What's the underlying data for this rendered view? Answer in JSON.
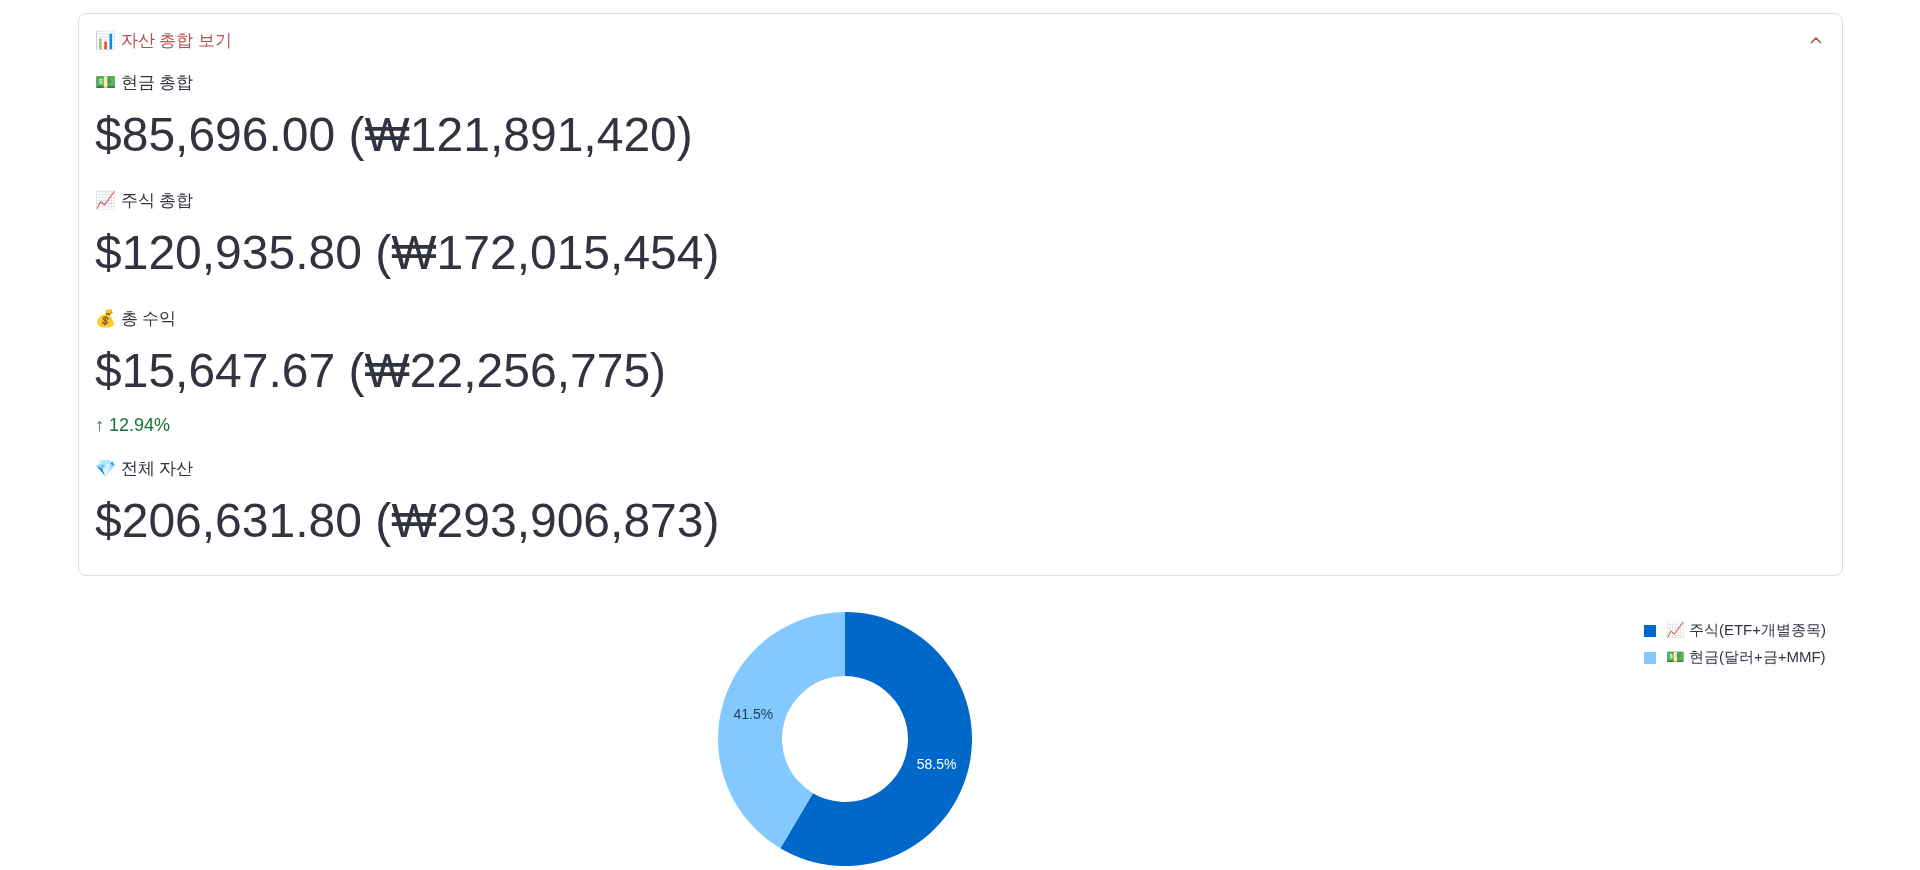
{
  "expander": {
    "title": "📊 자산 총합 보기",
    "expanded": true,
    "metrics": [
      {
        "label": "💵 현금 총합",
        "value": "$85,696.00 (₩121,891,420)"
      },
      {
        "label": "📈 주식 총합",
        "value": "$120,935.80 (₩172,015,454)"
      },
      {
        "label": "💰 총 수익",
        "value": "$15,647.67 (₩22,256,775)",
        "delta": {
          "text": "↑ 12.94%",
          "positive": true
        }
      },
      {
        "label": "💎 전체 자산",
        "value": "$206,631.80 (₩293,906,873)"
      }
    ]
  },
  "chart": {
    "chart_data": {
      "type": "donut",
      "categories": [
        "📈 주식(ETF+개별종목)",
        "💵 현금(달러+금+MMF)"
      ],
      "values": [
        58.5,
        41.5
      ],
      "value_labels": [
        "58.5%",
        "41.5%"
      ],
      "colors": [
        "#0068c9",
        "#83c9ff"
      ],
      "legend": "right"
    }
  }
}
